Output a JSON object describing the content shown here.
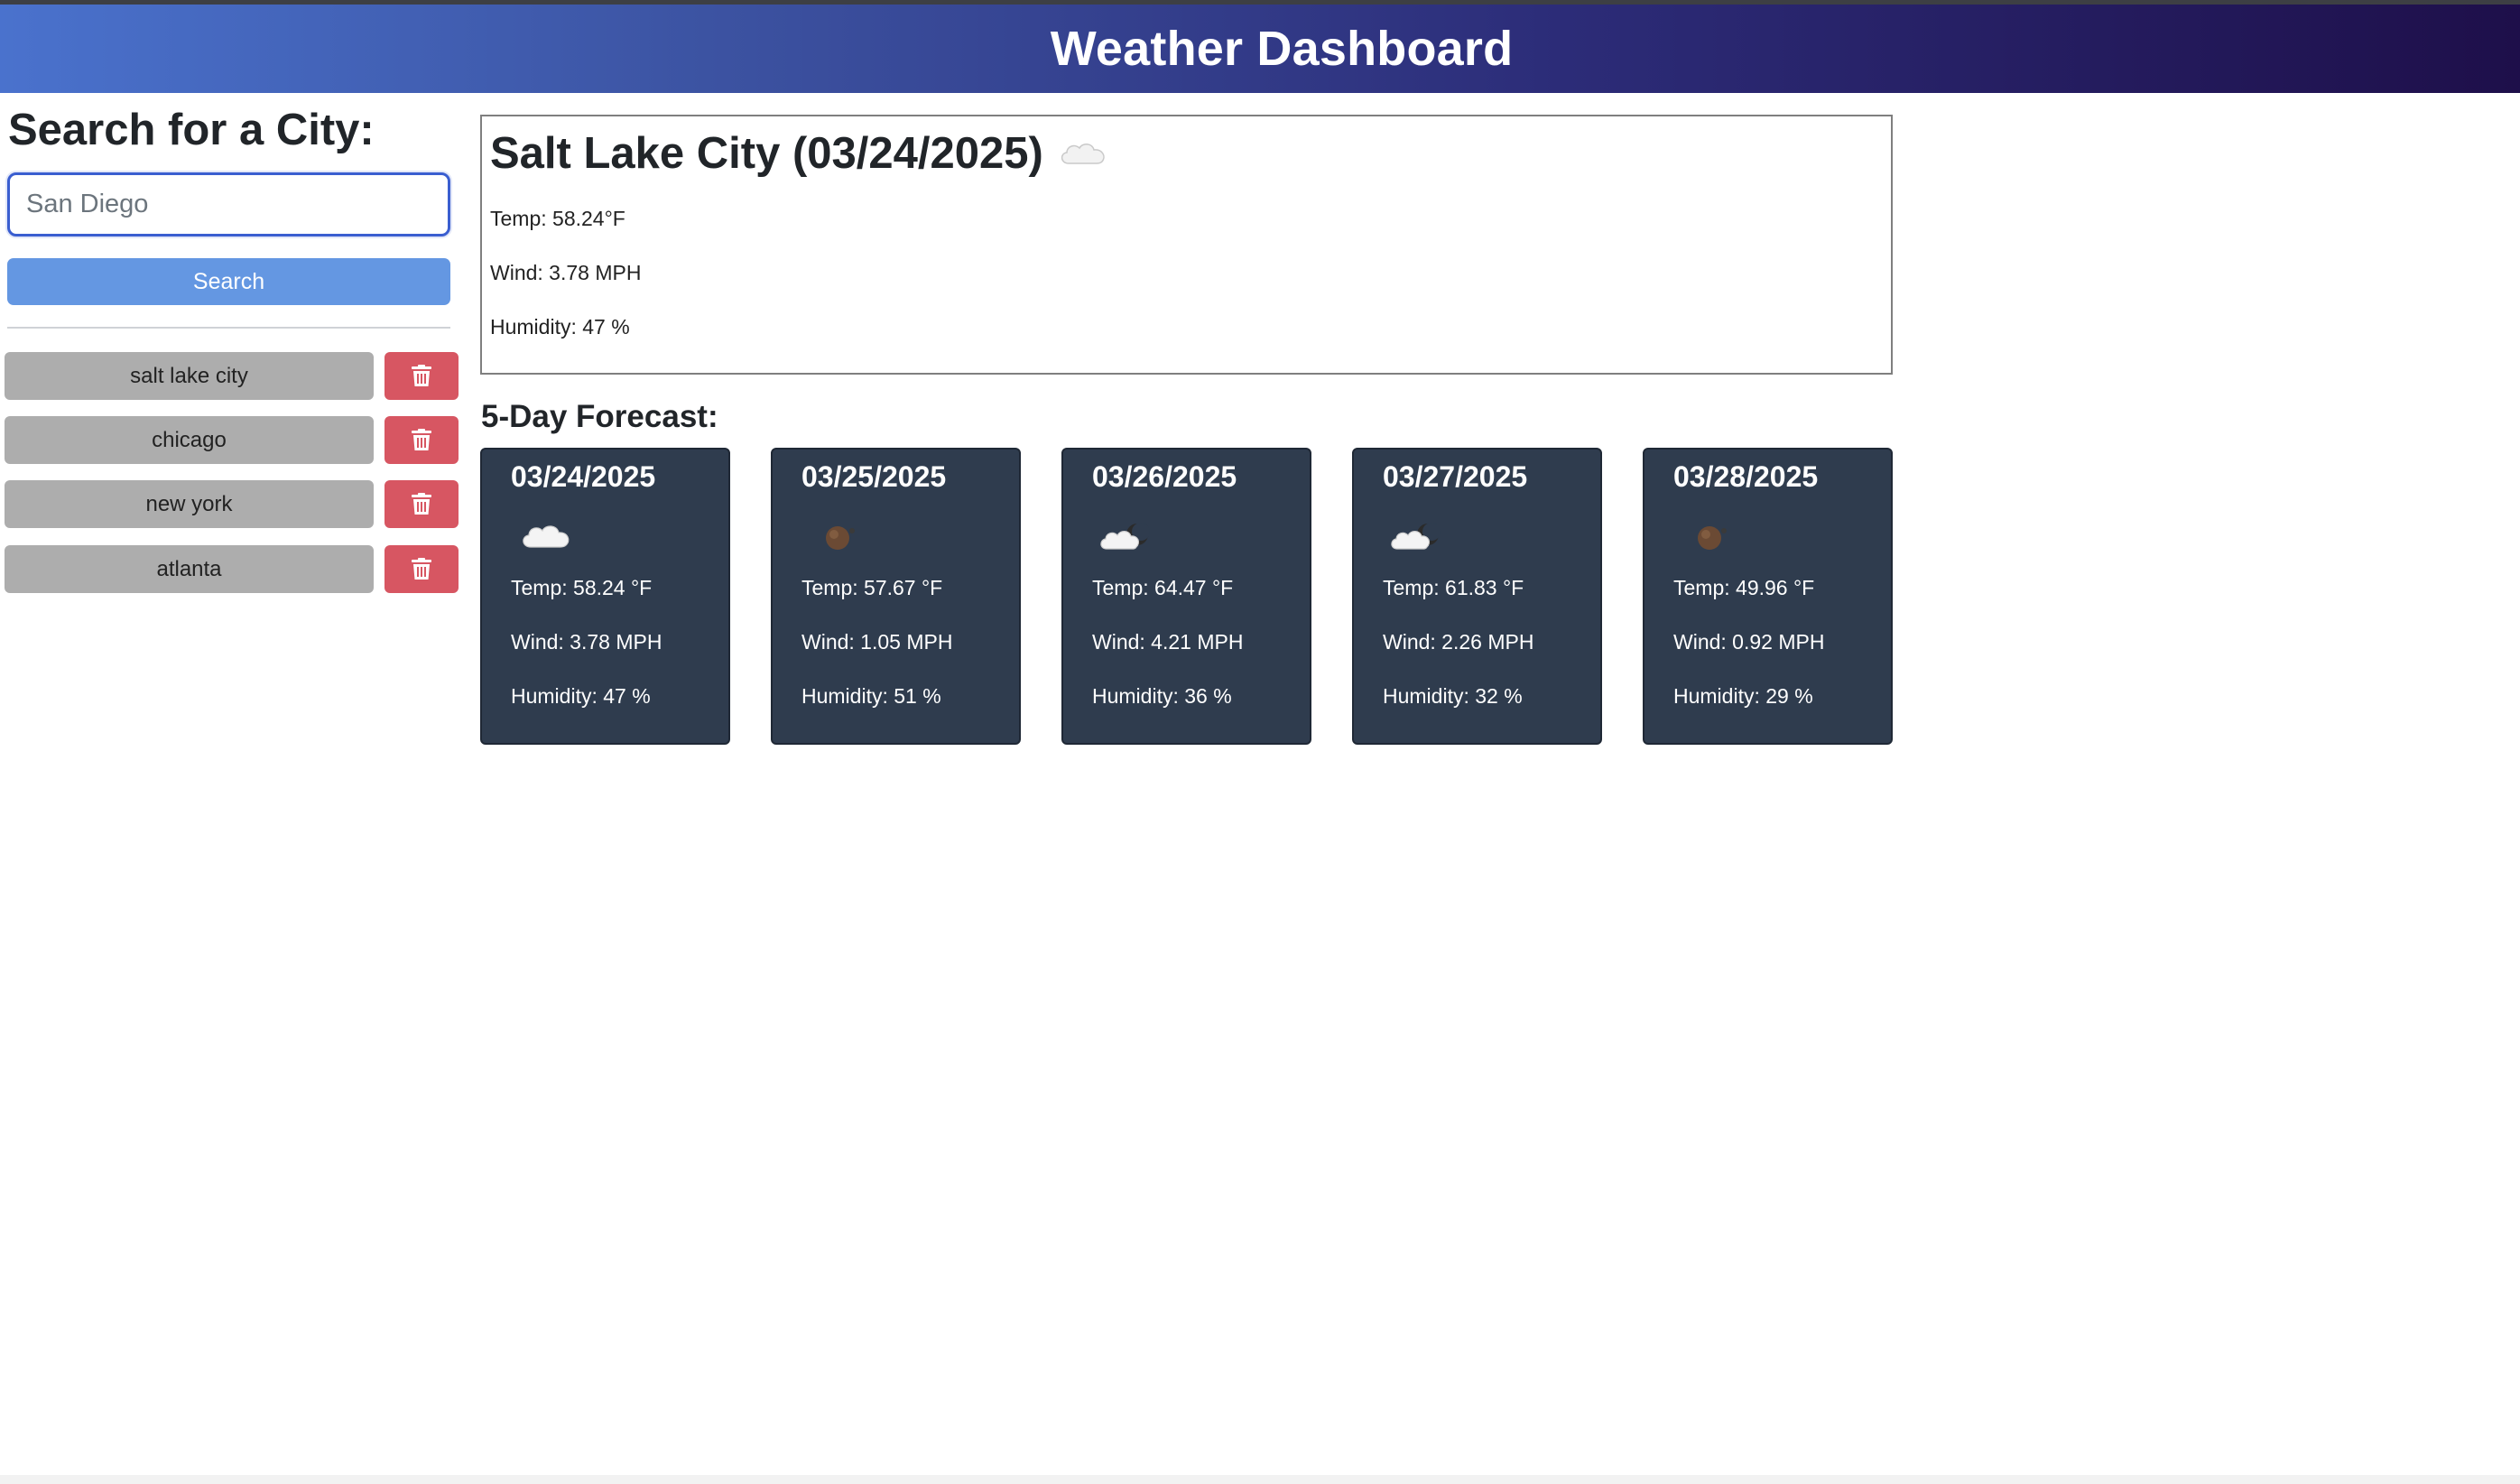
{
  "header": {
    "title": "Weather Dashboard"
  },
  "search": {
    "title": "Search for a City:",
    "placeholder": "San Diego",
    "button_label": "Search"
  },
  "history": [
    {
      "city": "salt lake city",
      "delete_icon": "trash-icon"
    },
    {
      "city": "chicago",
      "delete_icon": "trash-icon"
    },
    {
      "city": "new york",
      "delete_icon": "trash-icon"
    },
    {
      "city": "atlanta",
      "delete_icon": "trash-icon"
    }
  ],
  "today": {
    "title": "Salt Lake City (03/24/2025)",
    "icon": "cloud-icon",
    "temp": "Temp: 58.24°F",
    "wind": "Wind: 3.78 MPH",
    "humidity": "Humidity: 47 %"
  },
  "forecast": {
    "title": "5-Day Forecast:",
    "days": [
      {
        "date": "03/24/2025",
        "icon": "cloud-icon",
        "temp": "Temp: 58.24 °F",
        "wind": "Wind: 3.78 MPH",
        "humidity": "Humidity: 47 %"
      },
      {
        "date": "03/25/2025",
        "icon": "clear-night-icon",
        "temp": "Temp: 57.67 °F",
        "wind": "Wind: 1.05 MPH",
        "humidity": "Humidity: 51 %"
      },
      {
        "date": "03/26/2025",
        "icon": "cloudy-night-icon",
        "temp": "Temp: 64.47 °F",
        "wind": "Wind: 4.21 MPH",
        "humidity": "Humidity: 36 %"
      },
      {
        "date": "03/27/2025",
        "icon": "cloudy-night-icon",
        "temp": "Temp: 61.83 °F",
        "wind": "Wind: 2.26 MPH",
        "humidity": "Humidity: 32 %"
      },
      {
        "date": "03/28/2025",
        "icon": "clear-night-icon",
        "temp": "Temp: 49.96 °F",
        "wind": "Wind: 0.92 MPH",
        "humidity": "Humidity: 29 %"
      }
    ]
  },
  "colors": {
    "header_start": "#4a72cd",
    "header_end": "#1e0f4a",
    "search_button": "#6497e2",
    "history_button": "#adadad",
    "delete_button": "#d75662",
    "forecast_card": "#2f3c4e"
  }
}
